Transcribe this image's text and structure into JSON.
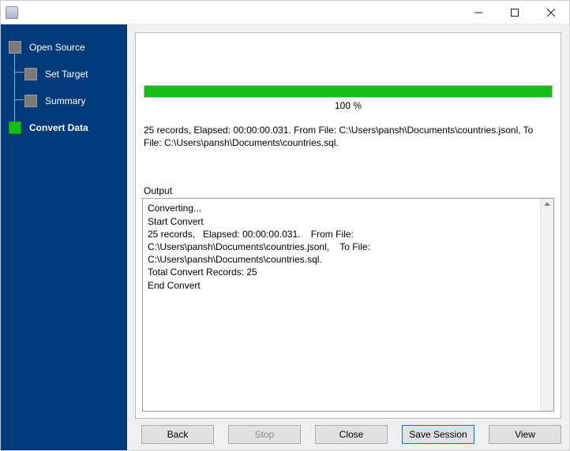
{
  "window": {
    "title": ""
  },
  "sidebar": {
    "items": [
      {
        "label": "Open Source",
        "active": false
      },
      {
        "label": "Set Target",
        "active": false
      },
      {
        "label": "Summary",
        "active": false
      },
      {
        "label": "Convert Data",
        "active": true
      }
    ]
  },
  "progress": {
    "percent": 100,
    "label": "100 %"
  },
  "status": "25 records,   Elapsed: 00:00:00.031.    From File: C:\\Users\\pansh\\Documents\\countries.jsonl,    To File: C:\\Users\\pansh\\Documents\\countries.sql.",
  "output": {
    "label": "Output",
    "lines": [
      "Converting...",
      "Start Convert",
      "25 records,   Elapsed: 00:00:00.031.    From File: C:\\Users\\pansh\\Documents\\countries.jsonl,    To File: C:\\Users\\pansh\\Documents\\countries.sql.",
      "Total Convert Records: 25",
      "End Convert"
    ]
  },
  "buttons": {
    "back": "Back",
    "stop": "Stop",
    "close": "Close",
    "save_session": "Save Session",
    "view": "View"
  },
  "colors": {
    "sidebar_bg": "#003a7a",
    "progress_green": "#17bd17",
    "accent_blue": "#0078d7"
  }
}
